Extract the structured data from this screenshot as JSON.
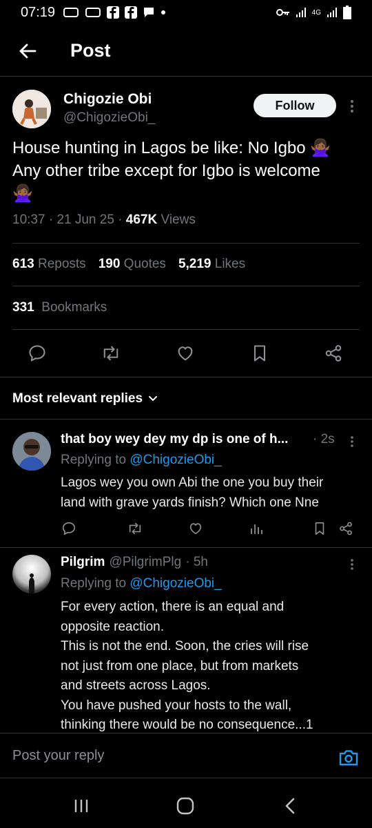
{
  "status_bar": {
    "time": "07:19",
    "network": "4G"
  },
  "app_bar": {
    "title": "Post"
  },
  "tweet": {
    "author_name": "Chigozie Obi",
    "author_handle": "@ChigozieObi_",
    "follow_label": "Follow",
    "text_line1": "House hunting in Lagos be like: No Igbo 🙅🏾‍♀️",
    "text_line2": "Any other tribe except for Igbo is welcome",
    "text_line3": "🙅🏾‍♀️",
    "time": "10:37",
    "date": "21 Jun 25",
    "views_count": "467K",
    "views_label": "Views",
    "reposts_count": "613",
    "reposts_label": "Reposts",
    "quotes_count": "190",
    "quotes_label": "Quotes",
    "likes_count": "5,219",
    "likes_label": "Likes",
    "bookmarks_count": "331",
    "bookmarks_label": "Bookmarks"
  },
  "replies_header": {
    "label": "Most relevant replies"
  },
  "replies": [
    {
      "name": "that boy wey dey my dp is one of h...",
      "meta": "· 2s",
      "replying_prefix": "Replying to",
      "replying_handle": "@ChigozieObi_",
      "line1": "Lagos wey you own Abi the one you buy their",
      "line2": "land with grave yards finish? Which one Nne"
    },
    {
      "name": "Pilgrim",
      "handle": "@PilgrimPlg",
      "meta": "· 5h",
      "replying_prefix": "Replying to",
      "replying_handle": "@ChigozieObi_",
      "line1": "For every action, there is an equal and",
      "line2": "opposite reaction.",
      "line3": "This is not the end. Soon, the cries will rise",
      "line4": "not just from one place, but from markets",
      "line5": "and streets across Lagos.",
      "line6": "You have pushed your hosts to the wall,",
      "line7": "thinking there would be no consequence...1"
    }
  ],
  "compose": {
    "placeholder": "Post your reply"
  },
  "colors": {
    "accent": "#1d9bf0",
    "muted": "#71767b",
    "background": "#000000"
  },
  "icons": [
    "back-arrow-icon",
    "more-icon",
    "reply-icon",
    "repost-icon",
    "like-icon",
    "bookmark-icon",
    "share-icon",
    "views-icon",
    "camera-icon",
    "chevron-down-icon"
  ]
}
